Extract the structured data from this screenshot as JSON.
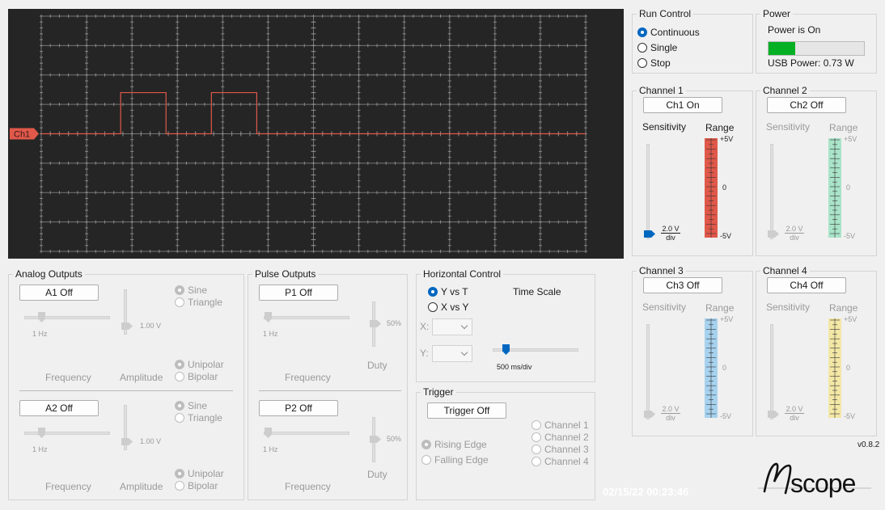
{
  "scope": {
    "channel_marker": "Ch1",
    "timestamp": "02/15/22 00:23:46",
    "colors": {
      "background": "#252525",
      "grid": "#8a8a8a",
      "ch1_trace": "#e0584a"
    }
  },
  "run_control": {
    "title": "Run Control",
    "options": [
      "Continuous",
      "Single",
      "Stop"
    ],
    "selected": "Continuous"
  },
  "power": {
    "title": "Power",
    "status": "Power is On",
    "usb_power": "USB Power: 0.73 W",
    "level": 0.28,
    "bar_color": "#06b025"
  },
  "channels": [
    {
      "title": "Channel 1",
      "button": "Ch1 On",
      "sensitivity_label": "Sensitivity",
      "range_label": "Range",
      "sens_num": "2.0 V",
      "sens_den": "div",
      "range_top": "+5V",
      "range_mid": "0",
      "range_bot": "-5V",
      "enabled": true,
      "color": "#e0584a"
    },
    {
      "title": "Channel 2",
      "button": "Ch2 Off",
      "sensitivity_label": "Sensitivity",
      "range_label": "Range",
      "sens_num": "2.0 V",
      "sens_den": "div",
      "range_top": "+5V",
      "range_mid": "0",
      "range_bot": "-5V",
      "enabled": false,
      "color": "#a9e3c8"
    },
    {
      "title": "Channel 3",
      "button": "Ch3 Off",
      "sensitivity_label": "Sensitivity",
      "range_label": "Range",
      "sens_num": "2.0 V",
      "sens_den": "div",
      "range_top": "+5V",
      "range_mid": "0",
      "range_bot": "-5V",
      "enabled": false,
      "color": "#a7d2ee"
    },
    {
      "title": "Channel 4",
      "button": "Ch4 Off",
      "sensitivity_label": "Sensitivity",
      "range_label": "Range",
      "sens_num": "2.0 V",
      "sens_den": "div",
      "range_top": "+5V",
      "range_mid": "0",
      "range_bot": "-5V",
      "enabled": false,
      "color": "#f3e7a6"
    }
  ],
  "analog": {
    "title": "Analog Outputs",
    "a1": {
      "button": "A1 Off",
      "freq_value": "1 Hz",
      "amp_value": "1.00 V",
      "wave": [
        "Sine",
        "Triangle"
      ],
      "polarity": [
        "Unipolar",
        "Bipolar"
      ],
      "freq_label": "Frequency",
      "amp_label": "Amplitude"
    },
    "a2": {
      "button": "A2 Off",
      "freq_value": "1 Hz",
      "amp_value": "1.00 V",
      "wave": [
        "Sine",
        "Triangle"
      ],
      "polarity": [
        "Unipolar",
        "Bipolar"
      ],
      "freq_label": "Frequency",
      "amp_label": "Amplitude"
    }
  },
  "pulse": {
    "title": "Pulse Outputs",
    "p1": {
      "button": "P1 Off",
      "freq_value": "1 Hz",
      "duty_value": "50%",
      "freq_label": "Frequency",
      "duty_label": "Duty"
    },
    "p2": {
      "button": "P2 Off",
      "freq_value": "1 Hz",
      "duty_value": "50%",
      "freq_label": "Frequency",
      "duty_label": "Duty"
    }
  },
  "horizontal": {
    "title": "Horizontal Control",
    "modes": [
      "Y vs T",
      "X vs Y"
    ],
    "selected": "Y vs T",
    "x_label": "X:",
    "y_label": "Y:",
    "time_scale_label": "Time Scale",
    "time_scale_value": "500 ms/div"
  },
  "trigger": {
    "title": "Trigger",
    "button": "Trigger Off",
    "edges": [
      "Rising Edge",
      "Falling Edge"
    ],
    "channels": [
      "Channel 1",
      "Channel 2",
      "Channel 3",
      "Channel 4"
    ]
  },
  "version": "v0.8.2",
  "logo_text": "scope"
}
